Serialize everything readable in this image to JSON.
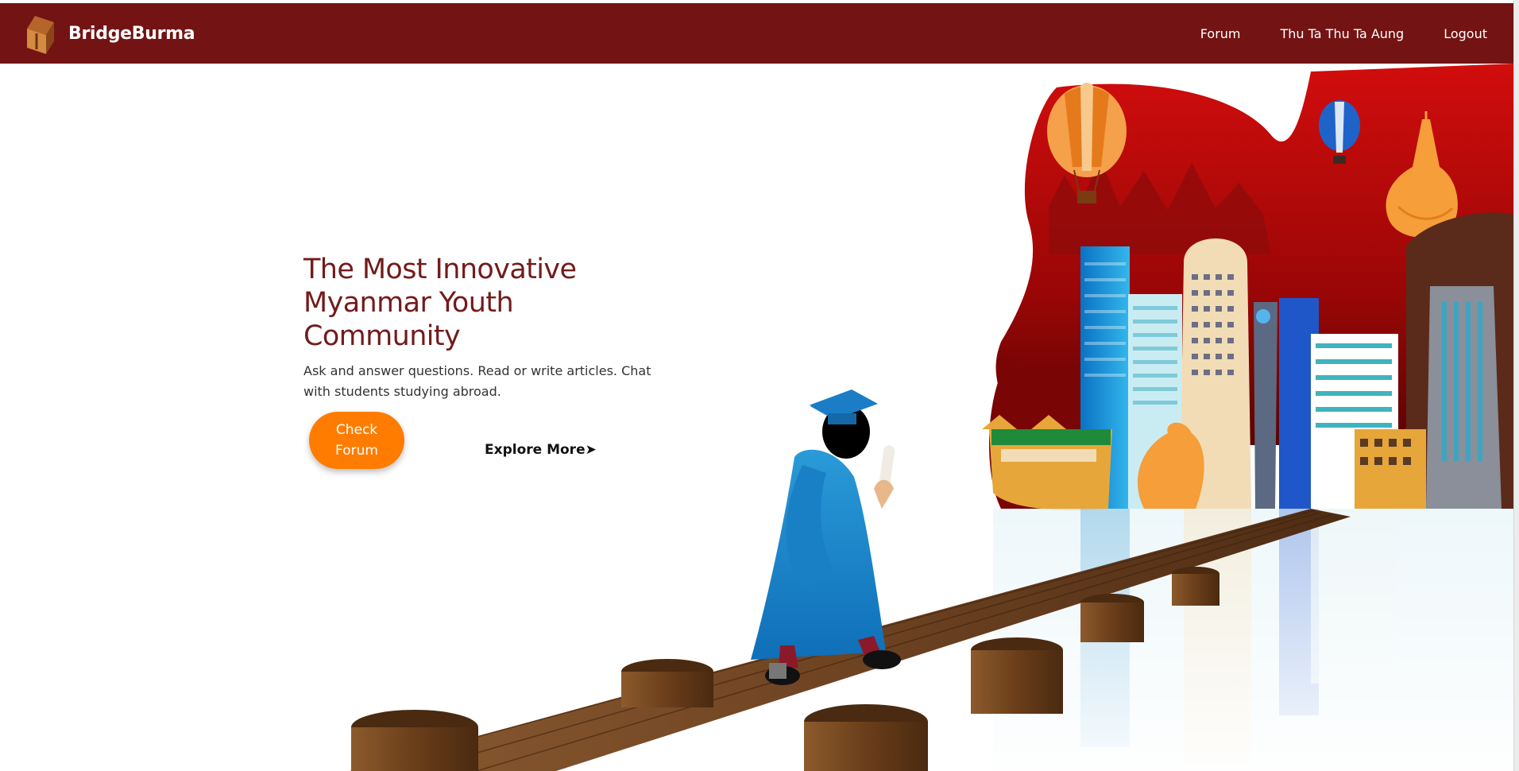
{
  "navbar": {
    "brand": "BridgeBurma",
    "links": {
      "forum": "Forum",
      "user": "Thu Ta Thu Ta Aung",
      "logout": "Logout"
    }
  },
  "hero": {
    "title": "The Most Innovative Myanmar Youth Community",
    "subtitle": "Ask and answer questions. Read or write articles. Chat with students studying abroad.",
    "primary_button": "Check Forum",
    "secondary_link": "Explore More➤"
  },
  "colors": {
    "navbar_bg": "#731313",
    "title": "#731b1b",
    "button": "#ff7c00"
  },
  "icons": {
    "logo": "bridge-logo-icon"
  }
}
